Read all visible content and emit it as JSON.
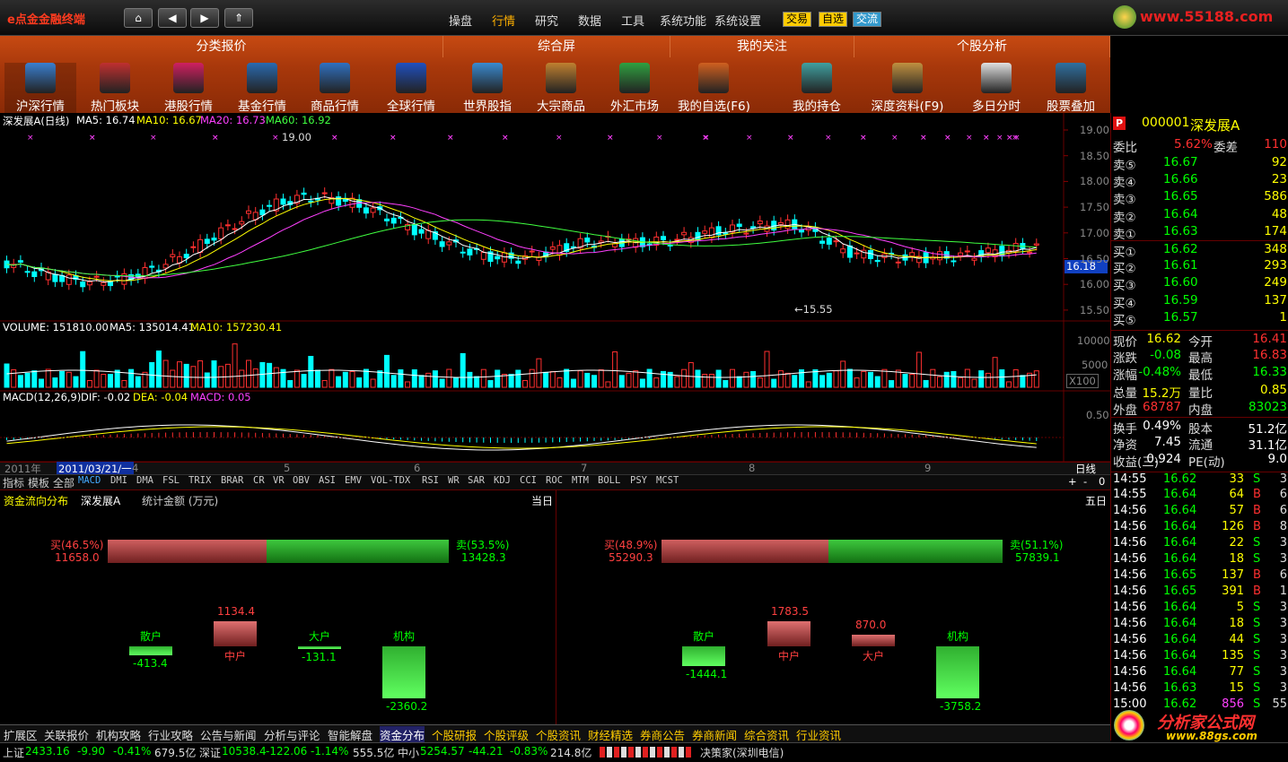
{
  "app": {
    "title": "e点金金融终端",
    "nav": [
      "⌂",
      "◀",
      "▶",
      "⇑"
    ],
    "menu": [
      "操盘",
      "行情",
      "研究",
      "数据",
      "工具",
      "系统功能",
      "系统设置"
    ],
    "active_menu": "行情",
    "mini": [
      "交易",
      "自选",
      "交流"
    ],
    "site": "www.55188.com"
  },
  "categories": [
    "分类报价",
    "综合屏",
    "我的关注",
    "个股分析"
  ],
  "tools": [
    "沪深行情",
    "热门板块",
    "港股行情",
    "基金行情",
    "商品行情",
    "全球行情",
    "世界股指",
    "大宗商品",
    "外汇市场",
    "我的自选(F6)",
    "我的持仓",
    "深度资料(F9)",
    "多日分时",
    "股票叠加"
  ],
  "kline": {
    "title": "深发展A(日线)",
    "ma5": "MA5: 16.74",
    "ma10": "MA10: 16.67",
    "ma20": "MA20: 16.73",
    "ma60": "MA60: 16.92",
    "high_mark": "19.00",
    "low_mark": "←15.55",
    "price_tag": "16.18",
    "yaxis": [
      "19.00",
      "18.50",
      "18.00",
      "17.50",
      "17.00",
      "16.50",
      "16.00",
      "15.50"
    ]
  },
  "volume": {
    "title": "VOLUME: 151810.00",
    "ma5": "MA5: 135014.41",
    "ma10": "MA10: 157230.41",
    "yaxis": [
      "10000",
      "5000"
    ],
    "unit": "X100"
  },
  "macd": {
    "title": "MACD(12,26,9)",
    "dif": "DIF: -0.02",
    "dea": "DEA: -0.04",
    "macd": "MACD: 0.05",
    "yaxis": "0.50"
  },
  "timeline": {
    "year": "2011年",
    "date": "2011/03/21/一",
    "months": [
      "4",
      "5",
      "6",
      "7",
      "8",
      "9"
    ],
    "period": "日线"
  },
  "indicators": [
    "指标",
    "模板",
    "全部",
    "MACD",
    "DMI",
    "DMA",
    "FSL",
    "TRIX",
    "BRAR",
    "CR",
    "VR",
    "OBV",
    "ASI",
    "EMV",
    "VOL-TDX",
    "RSI",
    "WR",
    "SAR",
    "KDJ",
    "CCI",
    "ROC",
    "MTM",
    "BOLL",
    "PSY",
    "MCST"
  ],
  "quote": {
    "code": "000001",
    "name": "深发展A",
    "weibi_label": "委比",
    "weibi": "5.62%",
    "weicha_label": "委差",
    "weicha": "110",
    "sell": [
      {
        "l": "卖⑤",
        "p": "16.67",
        "v": "92"
      },
      {
        "l": "卖④",
        "p": "16.66",
        "v": "23"
      },
      {
        "l": "卖③",
        "p": "16.65",
        "v": "586"
      },
      {
        "l": "卖②",
        "p": "16.64",
        "v": "48"
      },
      {
        "l": "卖①",
        "p": "16.63",
        "v": "174"
      }
    ],
    "buy": [
      {
        "l": "买①",
        "p": "16.62",
        "v": "348"
      },
      {
        "l": "买②",
        "p": "16.61",
        "v": "293"
      },
      {
        "l": "买③",
        "p": "16.60",
        "v": "249"
      },
      {
        "l": "买④",
        "p": "16.59",
        "v": "137"
      },
      {
        "l": "买⑤",
        "p": "16.57",
        "v": "1"
      }
    ],
    "stats": [
      [
        "现价",
        "16.62",
        "今开",
        "16.41"
      ],
      [
        "涨跌",
        "-0.08",
        "最高",
        "16.83"
      ],
      [
        "涨幅",
        "-0.48%",
        "最低",
        "16.33"
      ],
      [
        "总量",
        "15.2万",
        "量比",
        "0.85"
      ],
      [
        "外盘",
        "68787",
        "内盘",
        "83023"
      ]
    ],
    "stats2": [
      [
        "换手",
        "0.49%",
        "股本",
        "51.2亿"
      ],
      [
        "净资",
        "7.45",
        "流通",
        "31.1亿"
      ],
      [
        "收益(三)",
        "0.924",
        "PE(动)",
        "9.0"
      ]
    ]
  },
  "ticks": [
    [
      "14:55",
      "16.62",
      "33",
      "S",
      "3"
    ],
    [
      "14:55",
      "16.64",
      "64",
      "B",
      "6"
    ],
    [
      "14:56",
      "16.64",
      "57",
      "B",
      "6"
    ],
    [
      "14:56",
      "16.64",
      "126",
      "B",
      "8"
    ],
    [
      "14:56",
      "16.64",
      "22",
      "S",
      "3"
    ],
    [
      "14:56",
      "16.64",
      "18",
      "S",
      "3"
    ],
    [
      "14:56",
      "16.65",
      "137",
      "B",
      "6"
    ],
    [
      "14:56",
      "16.65",
      "391",
      "B",
      "1"
    ],
    [
      "14:56",
      "16.64",
      "5",
      "S",
      "3"
    ],
    [
      "14:56",
      "16.64",
      "18",
      "S",
      "3"
    ],
    [
      "14:56",
      "16.64",
      "44",
      "S",
      "3"
    ],
    [
      "14:56",
      "16.64",
      "135",
      "S",
      "3"
    ],
    [
      "14:56",
      "16.64",
      "77",
      "S",
      "3"
    ],
    [
      "14:56",
      "16.63",
      "15",
      "S",
      "3"
    ],
    [
      "15:00",
      "16.62",
      "856",
      "S",
      "55"
    ]
  ],
  "flow": {
    "title": "资金流向分布",
    "stock": "深发展A",
    "unit": "统计金额 (万元)",
    "left_period": "当日",
    "right_period": "五日",
    "left": {
      "buy_label": "买(46.5%)",
      "buy": "11658.0",
      "sell_label": "卖(53.5%)",
      "sell": "13428.3",
      "buy_pct": 46.5,
      "bars": [
        {
          "n": "散户",
          "v": "-413.4",
          "val": -413.4
        },
        {
          "n": "中户",
          "v": "1134.4",
          "val": 1134.4
        },
        {
          "n": "大户",
          "v": "-131.1",
          "val": -131.1
        },
        {
          "n": "机构",
          "v": "-2360.2",
          "val": -2360.2
        }
      ]
    },
    "right": {
      "buy_label": "买(48.9%)",
      "buy": "55290.3",
      "sell_label": "卖(51.1%)",
      "sell": "57839.1",
      "buy_pct": 48.9,
      "bars": [
        {
          "n": "散户",
          "v": "-1444.1",
          "val": -1444.1
        },
        {
          "n": "中户",
          "v": "1783.5",
          "val": 1783.5
        },
        {
          "n": "大户",
          "v": "870.0",
          "val": 870.0
        },
        {
          "n": "机构",
          "v": "-3758.2",
          "val": -3758.2
        }
      ]
    }
  },
  "bottom_tabs": [
    "扩展区",
    "关联报价",
    "机构攻略",
    "行业攻略",
    "公告与新闻",
    "分析与评论",
    "智能解盘",
    "资金分布",
    "个股研报",
    "个股评级",
    "个股资讯",
    "财经精选",
    "券商公告",
    "券商新闻",
    "综合资讯",
    "行业资讯"
  ],
  "active_tab": "资金分布",
  "status": {
    "sh_label": "上证",
    "sh": "2433.16",
    "sh_chg": "-9.90",
    "sh_pct": "-0.41%",
    "sh_amt": "679.5亿",
    "sz_label": "深证",
    "sz": "10538.4",
    "sz_chg": "-122.06",
    "sz_pct": "-1.14%",
    "sz_amt": "555.5亿",
    "zx_label": "中小",
    "zx": "5254.57",
    "zx_chg": "-44.21",
    "zx_pct": "-0.83%",
    "zx_amt": "214.8亿",
    "broker": "决策家(深圳电信)"
  },
  "watermark": {
    "name": "分析家公式网",
    "url": "www.88gs.com"
  },
  "colors": {
    "up": "#ff3030",
    "down": "#00ffff",
    "accent": "#c74a12",
    "yellow": "#ffff00",
    "green": "#00ff00"
  }
}
